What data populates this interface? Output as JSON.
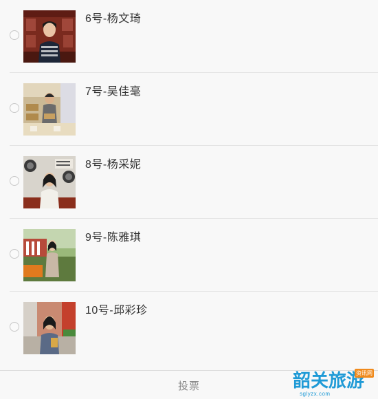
{
  "candidates": [
    {
      "label": "6号-杨文琦",
      "photo_icon": "candidate-photo"
    },
    {
      "label": "7号-吴佳毫",
      "photo_icon": "candidate-photo"
    },
    {
      "label": "8号-杨采妮",
      "photo_icon": "candidate-photo"
    },
    {
      "label": "9号-陈雅琪",
      "photo_icon": "candidate-photo"
    },
    {
      "label": "10号-邱彩珍",
      "photo_icon": "candidate-photo"
    }
  ],
  "footer": {
    "vote_label": "投票"
  },
  "watermark": {
    "main": "韶关旅游",
    "tag": "资讯网",
    "url": "sglyzx.com"
  },
  "colors": {
    "background": "#f8f8f8",
    "text": "#333333",
    "vote_text": "#888888",
    "watermark_blue": "#1f9ad6",
    "watermark_orange": "#f08a1c"
  }
}
